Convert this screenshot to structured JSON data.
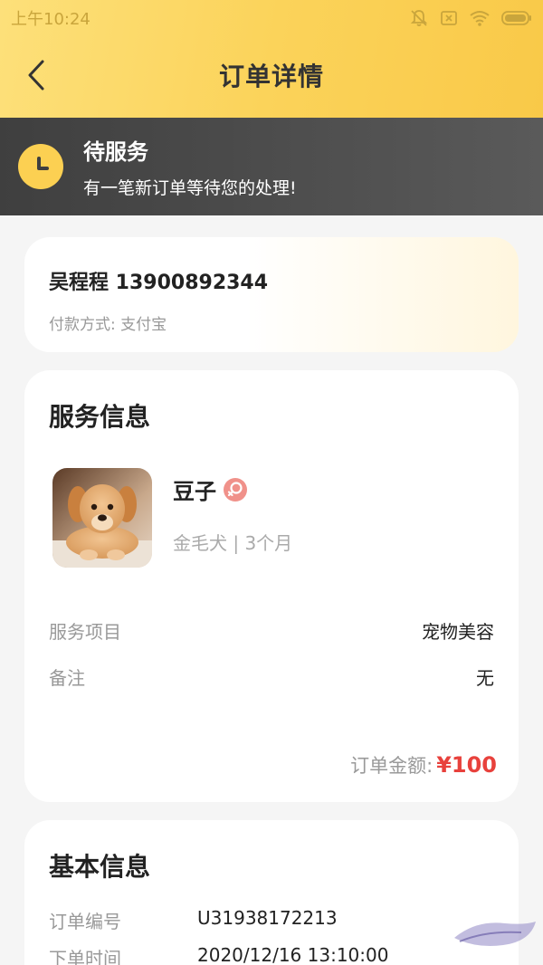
{
  "status_bar": {
    "time": "上午10:24",
    "icons": [
      "mute-bell-icon",
      "sim-x-icon",
      "wifi-icon",
      "battery-icon"
    ]
  },
  "nav": {
    "back_icon": "chevron-left-icon",
    "title": "订单详情"
  },
  "banner": {
    "icon": "clock-icon",
    "title": "待服务",
    "subtitle": "有一笔新订单等待您的处理!"
  },
  "customer": {
    "name_phone": "吴程程 13900892344",
    "payment": "付款方式: 支付宝"
  },
  "service": {
    "section_title": "服务信息",
    "pet": {
      "name": "豆子",
      "gender_icon": "female-icon",
      "meta": "金毛犬 | 3个月"
    },
    "rows": [
      {
        "label": "服务项目",
        "value": "宠物美容"
      },
      {
        "label": "备注",
        "value": "无"
      }
    ],
    "total_label": "订单金额:",
    "total_value": "¥100"
  },
  "basic": {
    "section_title": "基本信息",
    "rows": [
      {
        "label": "订单编号",
        "value": "U31938172213"
      },
      {
        "label": "下单时间",
        "value": "2020/12/16 13:10:00"
      }
    ]
  },
  "colors": {
    "header_yellow": "#fbd35a",
    "banner_dark": "#4a4a4a",
    "clock_yellow": "#fcd052",
    "price_red": "#e8413c",
    "gender_pink": "#f0918a"
  }
}
